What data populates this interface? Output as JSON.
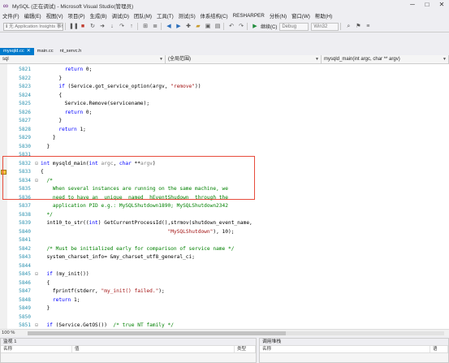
{
  "window": {
    "title": "MySQL (正在调试) - Microsoft Visual Studio(管理员)",
    "controls": [
      "─",
      "□",
      "✕"
    ]
  },
  "menu": [
    "文件(F)",
    "编辑(E)",
    "视图(V)",
    "项目(P)",
    "生成(B)",
    "调试(D)",
    "团队(M)",
    "工具(T)",
    "测试(S)",
    "体系结构(C)",
    "RESHARPER",
    "分析(N)",
    "窗口(W)",
    "帮助(H)"
  ],
  "toolbar": {
    "search_text": "ℹ 无 Application Insights 事件",
    "continue_label": "继续(C)",
    "config": "Debug",
    "platform": "Win32"
  },
  "tabs": [
    {
      "label": "mysqld.cc",
      "active": true,
      "close": "✕"
    },
    {
      "label": "main.cc",
      "active": false
    },
    {
      "label": "nt_servc.h",
      "active": false
    }
  ],
  "nav": {
    "project": "sql",
    "scope": "(全局范围)",
    "function": "mysqld_main(int argc, char ** argv)"
  },
  "code_lines": [
    {
      "ln": "5821",
      "fold": "",
      "segs": [
        [
          "",
          "        "
        ],
        [
          "kw",
          "return"
        ],
        [
          "",
          " 0;"
        ]
      ]
    },
    {
      "ln": "5822",
      "fold": "",
      "segs": [
        [
          "",
          "      }"
        ]
      ]
    },
    {
      "ln": "5823",
      "fold": "",
      "segs": [
        [
          "",
          "      "
        ],
        [
          "kw",
          "if"
        ],
        [
          "",
          " (Service.got_service_option(argv, "
        ],
        [
          "str",
          "\"remove\""
        ],
        [
          "",
          "))"
        ]
      ]
    },
    {
      "ln": "5824",
      "fold": "",
      "segs": [
        [
          "",
          "      {"
        ]
      ]
    },
    {
      "ln": "5825",
      "fold": "",
      "segs": [
        [
          "",
          "        Service.Remove(servicename);"
        ]
      ]
    },
    {
      "ln": "5826",
      "fold": "",
      "segs": [
        [
          "",
          "        "
        ],
        [
          "kw",
          "return"
        ],
        [
          "",
          " 0;"
        ]
      ]
    },
    {
      "ln": "5827",
      "fold": "",
      "segs": [
        [
          "",
          "      }"
        ]
      ]
    },
    {
      "ln": "5828",
      "fold": "",
      "segs": [
        [
          "",
          "      "
        ],
        [
          "kw",
          "return"
        ],
        [
          "",
          " 1;"
        ]
      ]
    },
    {
      "ln": "5829",
      "fold": "",
      "segs": [
        [
          "",
          "    }"
        ]
      ]
    },
    {
      "ln": "5830",
      "fold": "",
      "segs": [
        [
          "",
          "  }"
        ]
      ]
    },
    {
      "ln": "5831",
      "fold": "",
      "segs": [
        [
          "",
          ""
        ]
      ]
    },
    {
      "ln": "5832",
      "fold": "⊟",
      "segs": [
        [
          "kw",
          "int"
        ],
        [
          "",
          " mysqld_main("
        ],
        [
          "kw",
          "int"
        ],
        [
          "",
          " "
        ],
        [
          "param",
          "argc"
        ],
        [
          "",
          ", "
        ],
        [
          "kw",
          "char"
        ],
        [
          "",
          " **"
        ],
        [
          "param",
          "argv"
        ],
        [
          "",
          ")"
        ]
      ]
    },
    {
      "ln": "5833",
      "fold": "",
      "segs": [
        [
          "",
          "{"
        ]
      ]
    },
    {
      "ln": "5834",
      "fold": "⊟",
      "segs": [
        [
          "",
          "  "
        ],
        [
          "cm",
          "/*"
        ]
      ]
    },
    {
      "ln": "5835",
      "fold": "",
      "segs": [
        [
          "cm",
          "    When several instances are running on the same machine, we"
        ]
      ]
    },
    {
      "ln": "5836",
      "fold": "",
      "segs": [
        [
          "cm",
          "    need to have an  unique  named  hEventShudown  through the"
        ]
      ]
    },
    {
      "ln": "5837",
      "fold": "",
      "segs": [
        [
          "cm",
          "    application PID e.g.: MySQLShutdown1890; MySQLShutdown2342"
        ]
      ]
    },
    {
      "ln": "5838",
      "fold": "",
      "segs": [
        [
          "cm",
          "  */"
        ]
      ]
    },
    {
      "ln": "5839",
      "fold": "",
      "segs": [
        [
          "",
          "  int10_to_str(("
        ],
        [
          "kw",
          "int"
        ],
        [
          "",
          ") GetCurrentProcessId(),strmov(shutdown_event_name,"
        ]
      ]
    },
    {
      "ln": "5840",
      "fold": "",
      "segs": [
        [
          "",
          "                                          "
        ],
        [
          "str",
          "\"MySQLShutdown\""
        ],
        [
          "",
          "), 10);"
        ]
      ]
    },
    {
      "ln": "5841",
      "fold": "",
      "segs": [
        [
          "",
          ""
        ]
      ]
    },
    {
      "ln": "5842",
      "fold": "",
      "segs": [
        [
          "",
          "  "
        ],
        [
          "cm",
          "/* Must be initialized early for comparison of service name */"
        ]
      ]
    },
    {
      "ln": "5843",
      "fold": "",
      "segs": [
        [
          "",
          "  system_charset_info= &my_charset_utf8_general_ci;"
        ]
      ]
    },
    {
      "ln": "5844",
      "fold": "",
      "segs": [
        [
          "",
          ""
        ]
      ]
    },
    {
      "ln": "5845",
      "fold": "⊟",
      "segs": [
        [
          "",
          "  "
        ],
        [
          "kw",
          "if"
        ],
        [
          "",
          " (my_init())"
        ]
      ]
    },
    {
      "ln": "5846",
      "fold": "",
      "segs": [
        [
          "",
          "  {"
        ]
      ]
    },
    {
      "ln": "5847",
      "fold": "",
      "segs": [
        [
          "",
          "    fprintf(stderr, "
        ],
        [
          "str",
          "\"my_init() failed.\""
        ],
        [
          "",
          ");"
        ]
      ]
    },
    {
      "ln": "5848",
      "fold": "",
      "segs": [
        [
          "",
          "    "
        ],
        [
          "kw",
          "return"
        ],
        [
          "",
          " 1;"
        ]
      ]
    },
    {
      "ln": "5849",
      "fold": "",
      "segs": [
        [
          "",
          "  }"
        ]
      ]
    },
    {
      "ln": "5850",
      "fold": "",
      "segs": [
        [
          "",
          ""
        ]
      ]
    },
    {
      "ln": "5851",
      "fold": "⊟",
      "segs": [
        [
          "",
          "  "
        ],
        [
          "kw",
          "if"
        ],
        [
          "",
          " (Service.GetOS())  "
        ],
        [
          "cm",
          "/* true NT family */"
        ]
      ]
    }
  ],
  "current_line": "5833",
  "zoom": "100 %",
  "bottom_left": {
    "title": "监视 1",
    "columns": [
      "名称",
      "值",
      "类型"
    ]
  },
  "bottom_right": {
    "title": "调用堆栈",
    "columns": [
      "名称",
      "语"
    ]
  },
  "colors": {
    "accent": "#007acc",
    "highlight_box": "#e74c3c",
    "keyword": "#0000ff",
    "string": "#a31515",
    "comment": "#008000",
    "line_number": "#2b91af"
  }
}
